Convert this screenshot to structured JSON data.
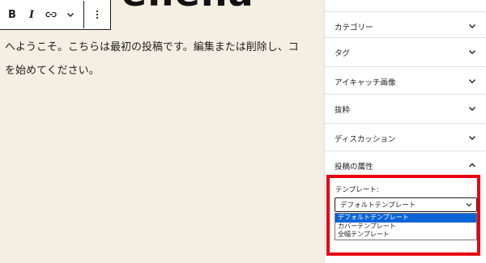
{
  "editor": {
    "heading_fragment": "ellena",
    "paragraph_line1": "へようこそ。こちらは最初の投稿です。編集または削除し、コ",
    "paragraph_line2": "を始めてください。",
    "toolbar": {
      "bold_label": "B",
      "italic_label": "I"
    }
  },
  "sidebar": {
    "panels": [
      {
        "label": "カテゴリー",
        "state": "collapsed"
      },
      {
        "label": "タグ",
        "state": "collapsed"
      },
      {
        "label": "アイキャッチ画像",
        "state": "collapsed"
      },
      {
        "label": "抜粋",
        "state": "collapsed"
      },
      {
        "label": "ディスカッション",
        "state": "collapsed"
      },
      {
        "label": "投稿の属性",
        "state": "expanded"
      }
    ],
    "template": {
      "label": "テンプレート:",
      "selected": "デフォルトテンプレート",
      "options": [
        "デフォルトテンプレート",
        "カバーテンプレート",
        "全幅テンプレート"
      ]
    }
  },
  "colors": {
    "editor_background": "#f5efe3",
    "highlight_border": "#e60012",
    "selected_option": "#0a64d8"
  }
}
